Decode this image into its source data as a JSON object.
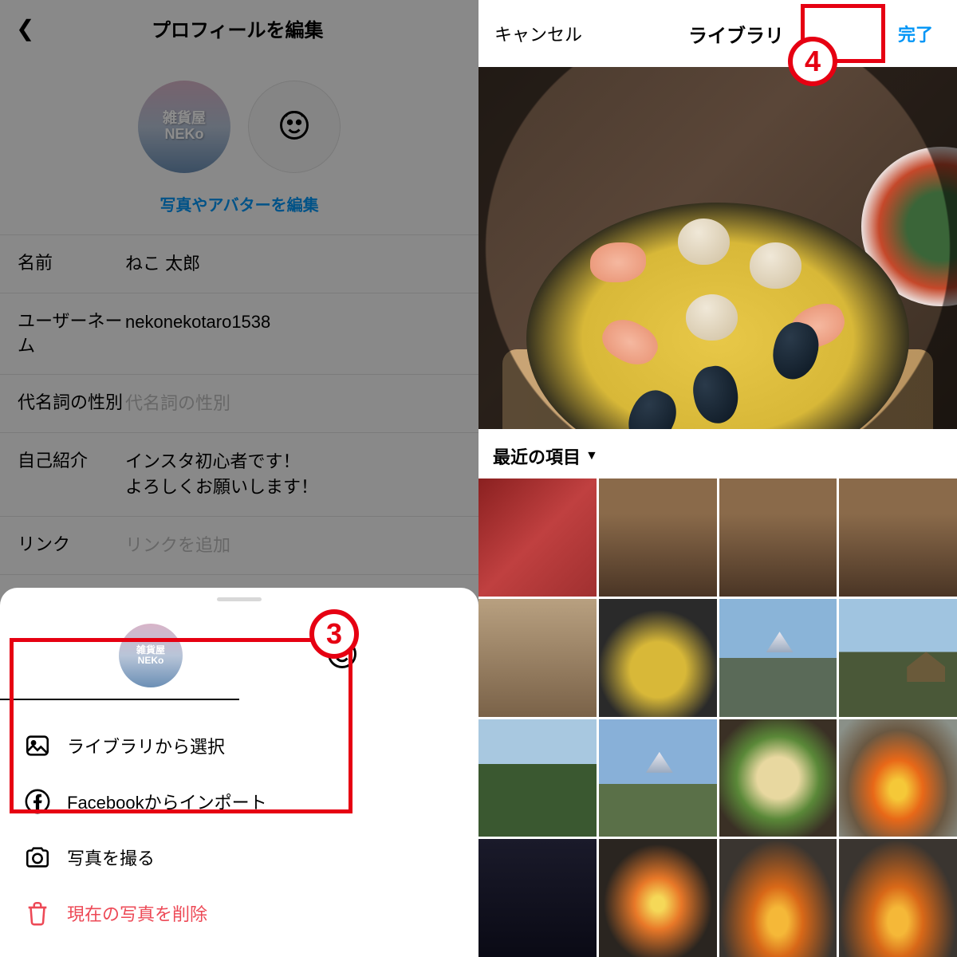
{
  "left": {
    "header_title": "プロフィールを編集",
    "avatar_text_line1": "雑貨屋",
    "avatar_text_line2": "NEKo",
    "edit_link": "写真やアバターを編集",
    "fields": {
      "name_label": "名前",
      "name_value": "ねこ 太郎",
      "username_label": "ユーザーネーム",
      "username_value": "nekonekotaro1538",
      "pronoun_label": "代名詞の性別",
      "pronoun_placeholder": "代名詞の性別",
      "bio_label": "自己紹介",
      "bio_value": "インスタ初心者です！\nよろしくお願いします！",
      "link_label": "リンク",
      "link_placeholder": "リンクを追加"
    }
  },
  "sheet": {
    "options": {
      "library": "ライブラリから選択",
      "facebook": "Facebookからインポート",
      "camera": "写真を撮る",
      "delete": "現在の写真を削除"
    }
  },
  "right": {
    "cancel": "キャンセル",
    "title": "ライブラリ",
    "done": "完了",
    "album": "最近の項目"
  },
  "annotations": {
    "step3": "3",
    "step4": "4"
  }
}
